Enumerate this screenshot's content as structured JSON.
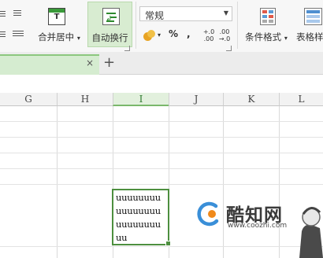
{
  "ribbon": {
    "merge_center": {
      "label": "合并居中",
      "icon": "merge-center-icon"
    },
    "wrap_text": {
      "label": "自动换行",
      "icon": "wrap-text-icon"
    },
    "number_format": {
      "value": "常规"
    },
    "percent": "%",
    "comma": ",",
    "increase_decimal": {
      "top": "+.0",
      "bottom": ".00"
    },
    "decrease_decimal": {
      "top": ".00",
      "bottom": "→.0"
    },
    "conditional_format": {
      "label": "条件格式"
    },
    "table_style": {
      "label": "表格样"
    }
  },
  "tabs": {
    "close_glyph": "×",
    "new_tab_glyph": "+"
  },
  "grid": {
    "columns": [
      "G",
      "H",
      "I",
      "J",
      "K",
      "L"
    ],
    "selected_column": "I",
    "active_cell": {
      "lines": [
        "uuuuuuuu",
        "uuuuuuuu",
        "uuuuuuuu",
        "uu"
      ]
    }
  },
  "watermark": {
    "name": "酷知网",
    "url": "www.coozhi.com"
  },
  "colors": {
    "accent_green": "#4d8f3f",
    "active_button_bg": "#d8ecd1"
  }
}
